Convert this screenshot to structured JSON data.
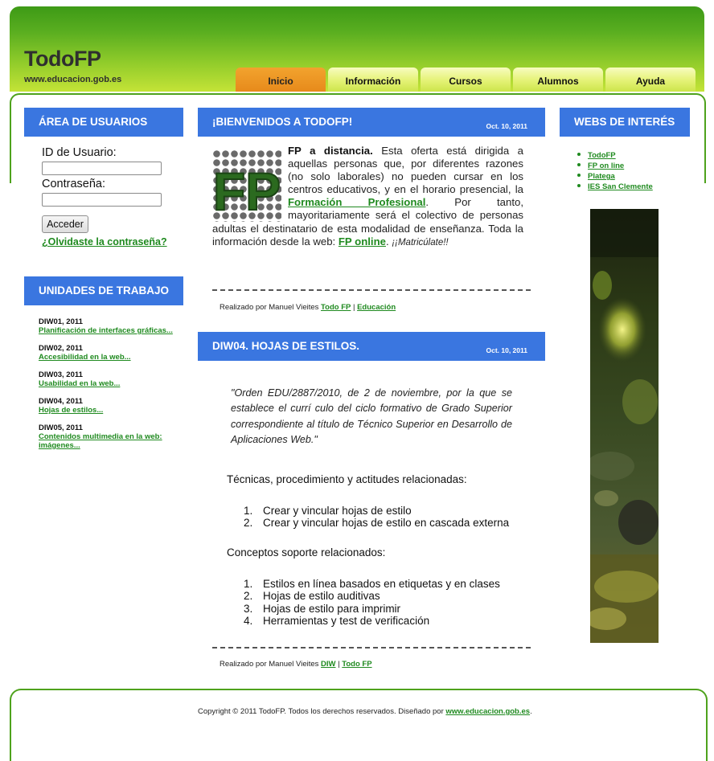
{
  "header": {
    "logo": "TodoFP",
    "domain": "www.educacion.gob.es",
    "nav": [
      {
        "label": "Inicio",
        "active": true
      },
      {
        "label": "Información",
        "active": false
      },
      {
        "label": "Cursos",
        "active": false
      },
      {
        "label": "Alumnos",
        "active": false
      },
      {
        "label": "Ayuda",
        "active": false
      }
    ]
  },
  "login": {
    "title": "ÁREA DE USUARIOS",
    "user_label": "ID de Usuario:",
    "user_value": "",
    "password_label": "Contraseña:",
    "password_value": "",
    "submit_label": "Acceder",
    "forgot_link": "¿Olvidaste la contraseña?"
  },
  "units": {
    "title": "UNIDADES DE TRABAJO",
    "items": [
      {
        "code": "DIW01, 2011",
        "link": "Planificación de interfaces gráficas..."
      },
      {
        "code": "DIW02, 2011",
        "link": "Accesibilidad en la web..."
      },
      {
        "code": "DIW03, 2011",
        "link": "Usabilidad en la web..."
      },
      {
        "code": "DIW04, 2011",
        "link": "Hojas de estilos..."
      },
      {
        "code": "DIW05, 2011",
        "link": "Contenidos multimedia en la web: imágenes..."
      }
    ]
  },
  "post1": {
    "title": "¡BIENVENIDOS A TODOFP!",
    "date": "Oct. 10, 2011",
    "logo_text": "FP",
    "lead": "FP a distancia.",
    "text_1": " Esta oferta está dirigida a aquellas personas que, por diferentes razones (no solo laborales) no pueden cursar en los centros educativos, y en el horario presencial, la ",
    "link_1": "Formación Profesional",
    "text_2": ". Por tanto, mayoritariamente será el colectivo de personas adultas el destinatario de esta modalidad de enseñanza. Toda la información desde la web: ",
    "link_2": "FP online",
    "text_3": ". ",
    "italic": "¡¡Matricúlate!!",
    "credit_prefix": "Realizado por Manuel Vieites ",
    "credit_link_1": "Todo FP",
    "credit_sep": " | ",
    "credit_link_2": "Educación"
  },
  "post2": {
    "title": "DIW04. HOJAS DE ESTILOS.",
    "date": "Oct. 10, 2011",
    "quote": "\"Orden EDU/2887/2010, de 2 de noviembre, por la que se establece el currí culo del ciclo formativo de Grado Superior correspondiente al título de Técnico Superior en Desarrollo de Aplicaciones Web.\"",
    "section_1": "Técnicas, procedimiento y actitudes relacionadas:",
    "list_1": [
      "Crear y vincular hojas de estilo",
      "Crear y vincular hojas de estilo en cascada externa"
    ],
    "section_2": "Conceptos soporte relacionados:",
    "list_2": [
      "Estilos en línea basados en etiquetas y en clases",
      "Hojas de estilo auditivas",
      "Hojas de estilo para imprimir",
      "Herramientas y test de verificación"
    ],
    "credit_prefix": "Realizado por Manuel Vieites ",
    "credit_link_1": "DIW",
    "credit_sep": " | ",
    "credit_link_2": "Todo FP"
  },
  "webs": {
    "title": "WEBS DE INTERÉS",
    "links": [
      "TodoFP",
      "FP on line",
      "Platega",
      "IES San Clemente"
    ]
  },
  "footer": {
    "text": "Copyright © 2011 TodoFP. Todos los derechos reservados. Diseñado por ",
    "link": "www.educacion.gob.es",
    "end": "."
  },
  "colors": {
    "header_green": "#5aae20",
    "panel_blue": "#3a76e0",
    "link_green": "#1f8a1f",
    "active_tab_orange": "#e78a1b",
    "tab_yellow": "#e6f37b"
  }
}
